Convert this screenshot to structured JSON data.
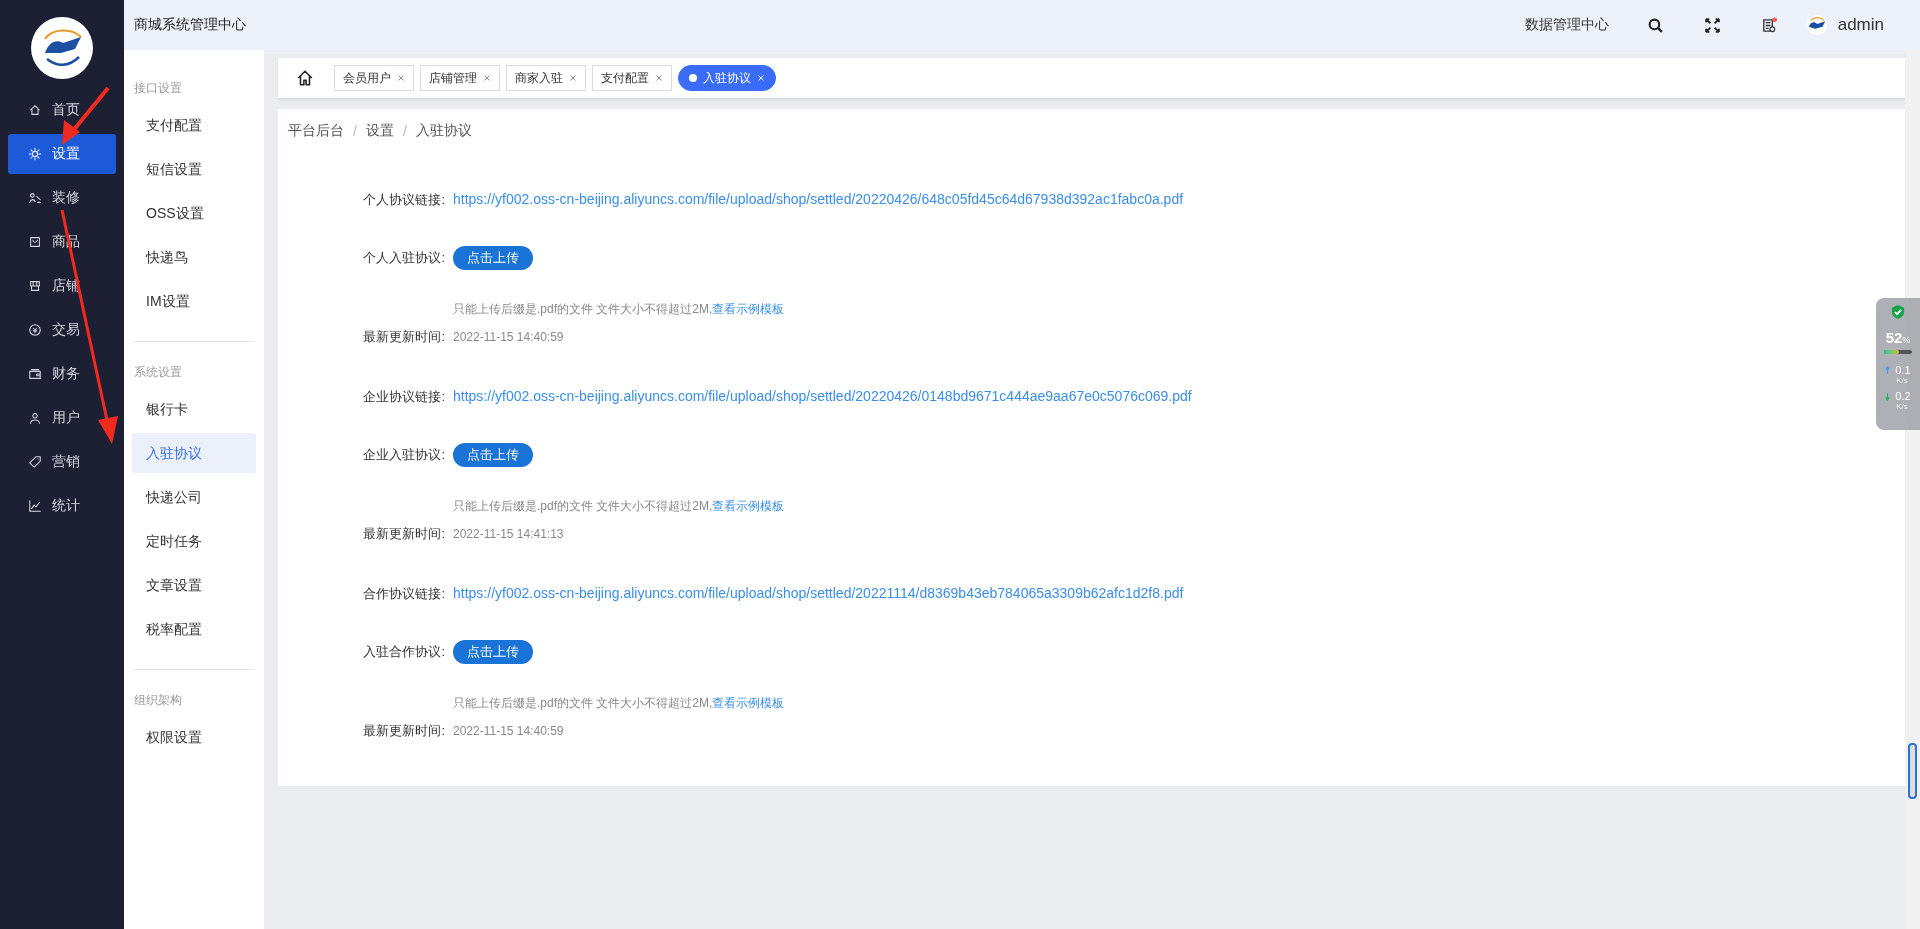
{
  "sidebar": {
    "items": [
      {
        "label": "首页",
        "kind": "home",
        "selected": false
      },
      {
        "label": "设置",
        "kind": "gear",
        "selected": true
      },
      {
        "label": "装修",
        "kind": "brush",
        "selected": false
      },
      {
        "label": "商品",
        "kind": "box",
        "selected": false
      },
      {
        "label": "店铺",
        "kind": "shop",
        "selected": false
      },
      {
        "label": "交易",
        "kind": "coin",
        "selected": false
      },
      {
        "label": "财务",
        "kind": "wallet",
        "selected": false
      },
      {
        "label": "用户",
        "kind": "user",
        "selected": false
      },
      {
        "label": "营销",
        "kind": "tag",
        "selected": false
      },
      {
        "label": "统计",
        "kind": "chart",
        "selected": false
      }
    ]
  },
  "submenu": [
    {
      "title": "接口设置",
      "items": [
        {
          "label": "支付配置",
          "selected": false
        },
        {
          "label": "短信设置",
          "selected": false
        },
        {
          "label": "OSS设置",
          "selected": false
        },
        {
          "label": "快递鸟",
          "selected": false
        },
        {
          "label": "IM设置",
          "selected": false
        }
      ]
    },
    {
      "title": "系统设置",
      "items": [
        {
          "label": "银行卡",
          "selected": false
        },
        {
          "label": "入驻协议",
          "selected": true
        },
        {
          "label": "快递公司",
          "selected": false
        },
        {
          "label": "定时任务",
          "selected": false
        },
        {
          "label": "文章设置",
          "selected": false
        },
        {
          "label": "税率配置",
          "selected": false
        }
      ]
    },
    {
      "title": "组织架构",
      "items": [
        {
          "label": "权限设置",
          "selected": false
        }
      ]
    }
  ],
  "header": {
    "title": "商城系统管理中心",
    "link": "数据管理中心",
    "user": "admin",
    "has_notification": true
  },
  "tabs": [
    {
      "label": "会员用户",
      "selected": false
    },
    {
      "label": "店铺管理",
      "selected": false
    },
    {
      "label": "商家入驻",
      "selected": false
    },
    {
      "label": "支付配置",
      "selected": false
    },
    {
      "label": "入驻协议",
      "selected": true
    }
  ],
  "breadcrumb": [
    "平台后台",
    "设置",
    "入驻协议"
  ],
  "breadcrumb_separator": "/",
  "form": [
    {
      "kind": "link",
      "label": "个人协议链接:",
      "value": "https://yf002.oss-cn-beijing.aliyuncs.com/file/upload/shop/settled/20220426/648c05fd45c64d67938d392ac1fabc0a.pdf"
    },
    {
      "kind": "upload",
      "label": "个人入驻协议:",
      "value": "点击上传"
    },
    {
      "kind": "tip",
      "value": "只能上传后缀是.pdf的文件 文件大小不得超过2M,",
      "link": "查看示例模板"
    },
    {
      "kind": "time",
      "label": "最新更新时间:",
      "value": "2022-11-15 14:40:59"
    },
    {
      "kind": "link",
      "label": "企业协议链接:",
      "value": "https://yf002.oss-cn-beijing.aliyuncs.com/file/upload/shop/settled/20220426/0148bd9671c444ae9aa67e0c5076c069.pdf"
    },
    {
      "kind": "upload",
      "label": "企业入驻协议:",
      "value": "点击上传"
    },
    {
      "kind": "tip",
      "value": "只能上传后缀是.pdf的文件 文件大小不得超过2M,",
      "link": "查看示例模板"
    },
    {
      "kind": "time",
      "label": "最新更新时间:",
      "value": "2022-11-15 14:41:13"
    },
    {
      "kind": "link",
      "label": "合作协议链接:",
      "value": "https://yf002.oss-cn-beijing.aliyuncs.com/file/upload/shop/settled/20221114/d8369b43eb784065a3309b62afc1d2f8.pdf"
    },
    {
      "kind": "upload",
      "label": "入驻合作协议:",
      "value": "点击上传"
    },
    {
      "kind": "tip",
      "value": "只能上传后缀是.pdf的文件 文件大小不得超过2M,",
      "link": "查看示例模板"
    },
    {
      "kind": "time",
      "label": "最新更新时间:",
      "value": "2022-11-15 14:40:59"
    }
  ],
  "monitor": {
    "percent": "52",
    "unit": "%",
    "level": 0.52,
    "up": "0.1",
    "up_unit": "K/s",
    "down": "0.2",
    "down_unit": "K/s"
  }
}
